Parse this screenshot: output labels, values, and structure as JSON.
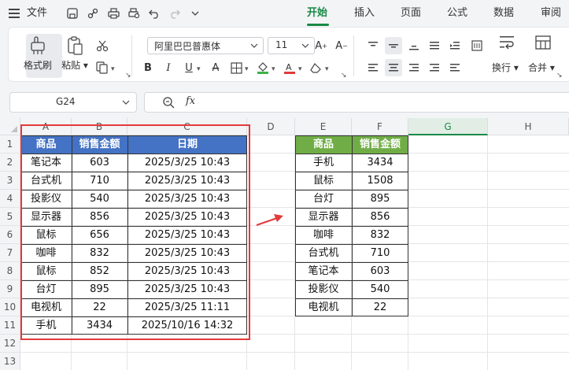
{
  "menubar": {
    "file_label": "文件",
    "tabs": [
      {
        "label": "开始",
        "active": true
      },
      {
        "label": "插入",
        "active": false
      },
      {
        "label": "页面",
        "active": false
      },
      {
        "label": "公式",
        "active": false
      },
      {
        "label": "数据",
        "active": false
      },
      {
        "label": "审阅",
        "active": false
      }
    ],
    "accent_color": "#188a45"
  },
  "ribbon": {
    "format_painter_label": "格式刷",
    "paste_label": "粘贴",
    "font_name": "阿里巴巴普惠体",
    "font_size": "11",
    "wrap_label": "换行",
    "merge_label": "合并"
  },
  "formula_bar": {
    "cell_ref": "G24",
    "fx_label": "fx",
    "formula": ""
  },
  "grid": {
    "columns": [
      "A",
      "B",
      "C",
      "D",
      "E",
      "F",
      "G",
      "H"
    ],
    "selected_column": "G",
    "rows": [
      "1",
      "2",
      "3",
      "4",
      "5",
      "6",
      "7",
      "8",
      "9",
      "10",
      "11",
      "12",
      "13"
    ],
    "left_table": {
      "header_color": "#4472c4",
      "headers": [
        "商品",
        "销售金额",
        "日期"
      ],
      "rows": [
        [
          "笔记本",
          "603",
          "2025/3/25 10:43"
        ],
        [
          "台式机",
          "710",
          "2025/3/25 10:43"
        ],
        [
          "投影仪",
          "540",
          "2025/3/25 10:43"
        ],
        [
          "显示器",
          "856",
          "2025/3/25 10:43"
        ],
        [
          "鼠标",
          "656",
          "2025/3/25 10:43"
        ],
        [
          "咖啡",
          "832",
          "2025/3/25 10:43"
        ],
        [
          "鼠标",
          "852",
          "2025/3/25 10:43"
        ],
        [
          "台灯",
          "895",
          "2025/3/25 10:43"
        ],
        [
          "电视机",
          "22",
          "2025/3/25 11:11"
        ],
        [
          "手机",
          "3434",
          "2025/10/16 14:32"
        ]
      ]
    },
    "right_table": {
      "header_color": "#70ad47",
      "headers": [
        "商品",
        "销售金额"
      ],
      "rows": [
        [
          "手机",
          "3434"
        ],
        [
          "鼠标",
          "1508"
        ],
        [
          "台灯",
          "895"
        ],
        [
          "显示器",
          "856"
        ],
        [
          "咖啡",
          "832"
        ],
        [
          "台式机",
          "710"
        ],
        [
          "笔记本",
          "603"
        ],
        [
          "投影仪",
          "540"
        ],
        [
          "电视机",
          "22"
        ]
      ]
    },
    "highlight_color": "#e23a3a"
  }
}
